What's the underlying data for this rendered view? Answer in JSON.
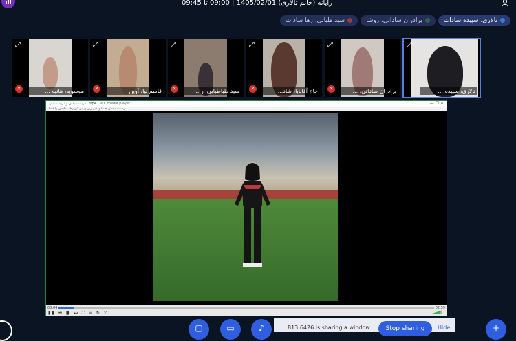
{
  "meeting": {
    "title": "رایانه (خانم تالاری) 1405/02/01 | 09:00 تا 09:45"
  },
  "chips": [
    {
      "label": "تالاری، سپیده سادات",
      "color": "#2f7de0",
      "active": true
    },
    {
      "label": "برادران ساداتی، روشا",
      "color": "#2d6b48",
      "active": false
    },
    {
      "label": "سید طباتی، رها سادات",
      "color": "#a13b3b",
      "active": false
    }
  ],
  "participants": [
    {
      "name": "موسویه، هانیه ...",
      "bg": "#d9d6d1",
      "person": "#c49b8a"
    },
    {
      "name": "قاسم نیا، آوین",
      "bg": "#c3ad92",
      "person": "#b88a72"
    },
    {
      "name": "سید طباطبایی، ر...",
      "bg": "#8c7c70",
      "person": "#3a3038"
    },
    {
      "name": "حاج آقابابا، شاد...",
      "bg": "#b9b2a9",
      "person": "#5a3a30"
    },
    {
      "name": "برادران ساداتی، ...",
      "bg": "#cfc8c3",
      "person": "#a07a76"
    },
    {
      "name": "تالاری، سپیده ...",
      "bg": "#e6e4e2",
      "person": "#1e1d22"
    }
  ],
  "share": {
    "window_title": "تمرینات بدنی و تربیت بدنی.mp4 - VLC media player",
    "menu": "رسانه  پخش  صدا  ویدیو  زیرنویس  ابزارها  نمایش  راهنما",
    "time_start": "00:04",
    "time_end": "02:59",
    "progress_fraction": 0.04
  },
  "toolbar": {
    "chat_icon": "chat-icon",
    "camera_icon": "camera-icon",
    "mic_icon": "mic-icon",
    "add_icon": "plus-icon"
  },
  "stop_sharing": {
    "message": "813.6426 is sharing a window",
    "button": "Stop sharing",
    "hide": "Hide"
  }
}
